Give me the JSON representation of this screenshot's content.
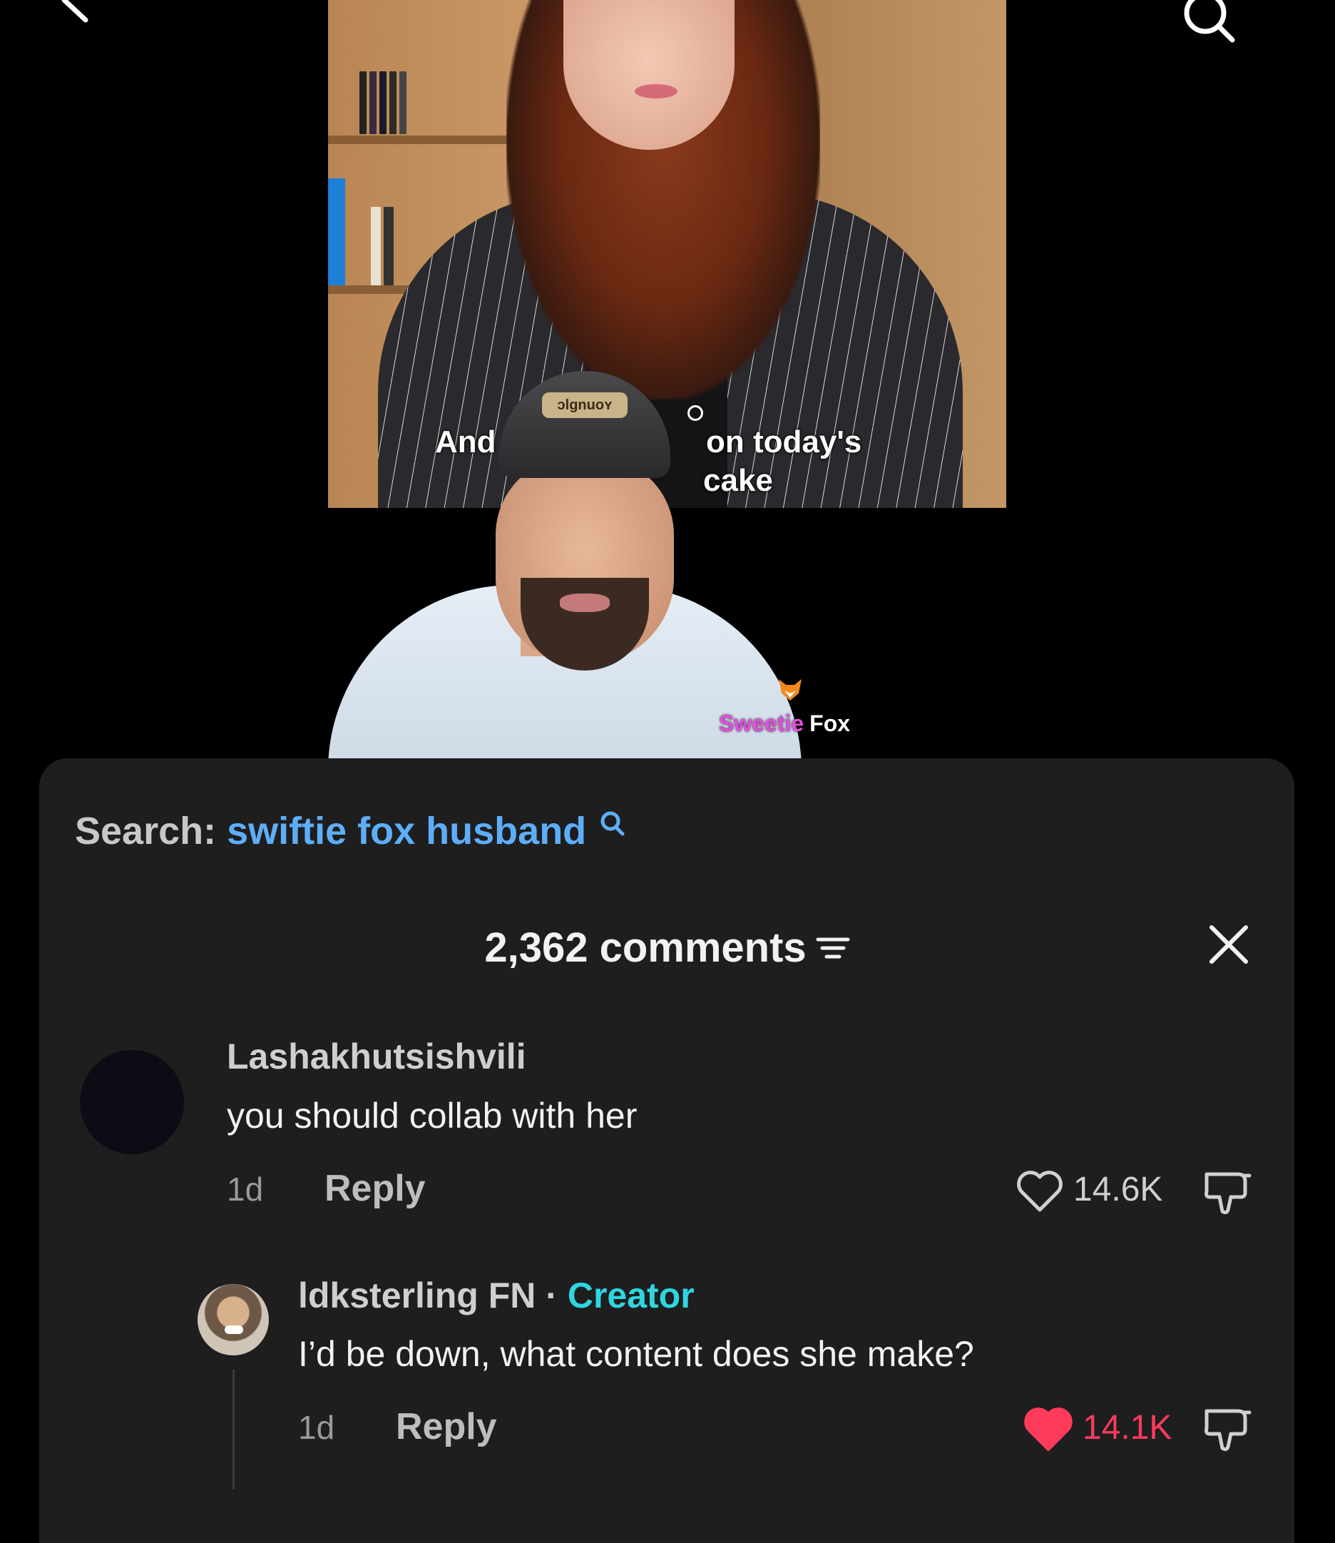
{
  "video": {
    "caption_line1_left": "And",
    "caption_line1_right": "on today's",
    "caption_line2_right": "cake",
    "watermark_pink": "Sweetie",
    "watermark_white": "Fox",
    "cap_text": "ɔlgnuoʏ"
  },
  "search": {
    "label": "Search:",
    "term": "swiftie fox husband"
  },
  "comments_header": {
    "count_label": "2,362 comments"
  },
  "comments": [
    {
      "username": "Lashakhutsishvili",
      "text": "you should collab with her",
      "age": "1d",
      "reply_label": "Reply",
      "likes": "14.6K",
      "liked": false
    },
    {
      "username": "ldksterling FN",
      "separator": "·",
      "creator_label": "Creator",
      "text": "I’d be down, what content does she make?",
      "age": "1d",
      "reply_label": "Reply",
      "likes": "14.1K",
      "liked": true
    }
  ],
  "colors": {
    "search_term": "#5eaef7",
    "creator_tag": "#2fd6e0",
    "liked_heart": "#ff3b5c",
    "panel_bg": "#1e1e1f"
  },
  "icons": [
    "back-chevron-icon",
    "search-icon",
    "search-small-icon",
    "filter-icon",
    "close-icon",
    "heart-outline-icon",
    "heart-filled-icon",
    "dislike-icon",
    "fox-icon"
  ]
}
